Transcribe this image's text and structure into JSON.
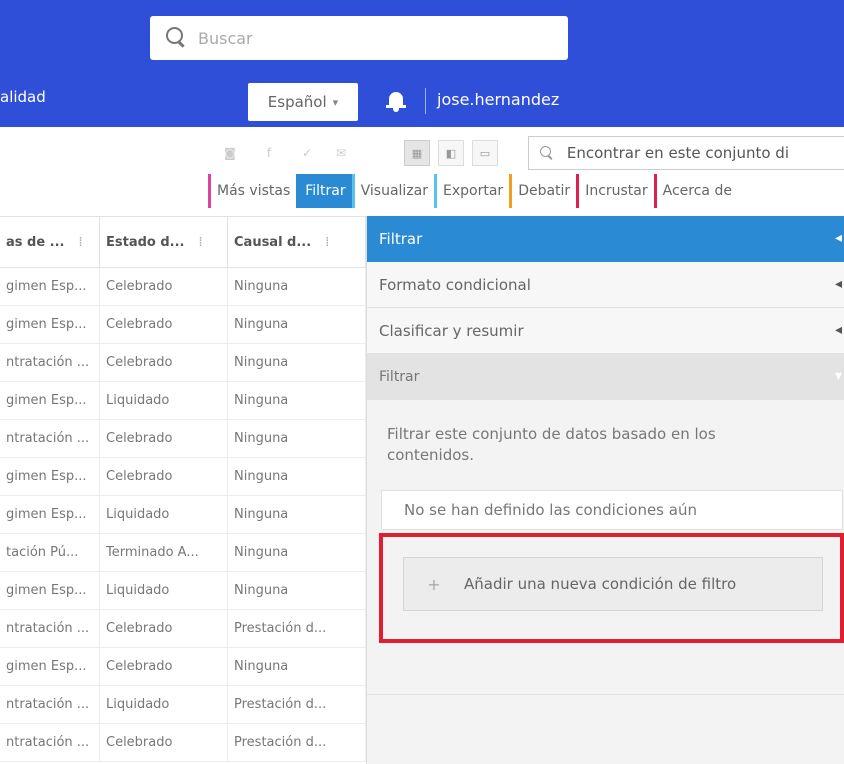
{
  "header": {
    "search_placeholder": "Buscar",
    "nav_left_label": "alidad",
    "language": "Español",
    "user_name": "jose.hernandez"
  },
  "toolbar": {
    "find_placeholder": "Encontrar en este conjunto di",
    "tabs": [
      {
        "label": "Más vistas",
        "color": "#e040a0"
      },
      {
        "label": "Filtrar",
        "color": "#2a8ad4",
        "active": true
      },
      {
        "label": "Visualizar",
        "color": "#5bc0eb"
      },
      {
        "label": "Exportar",
        "color": "#5bc0eb"
      },
      {
        "label": "Debatir",
        "color": "#f0a020"
      },
      {
        "label": "Incrustar",
        "color": "#e01e50"
      },
      {
        "label": "Acerca de",
        "color": "#e01e50"
      }
    ]
  },
  "grid": {
    "headers": [
      "as de ...",
      "Estado d...",
      "Causal d..."
    ],
    "rows": [
      [
        "gimen Esp...",
        "Celebrado",
        "Ninguna"
      ],
      [
        "gimen Esp...",
        "Celebrado",
        "Ninguna"
      ],
      [
        "ntratación ...",
        "Celebrado",
        "Ninguna"
      ],
      [
        "gimen Esp...",
        "Liquidado",
        "Ninguna"
      ],
      [
        "ntratación ...",
        "Celebrado",
        "Ninguna"
      ],
      [
        "gimen Esp...",
        "Celebrado",
        "Ninguna"
      ],
      [
        "gimen Esp...",
        "Liquidado",
        "Ninguna"
      ],
      [
        "tación Pú...",
        "Terminado A...",
        "Ninguna"
      ],
      [
        "gimen Esp...",
        "Liquidado",
        "Ninguna"
      ],
      [
        "ntratación ...",
        "Celebrado",
        "Prestación d..."
      ],
      [
        "gimen Esp...",
        "Celebrado",
        "Ninguna"
      ],
      [
        "ntratación ...",
        "Liquidado",
        "Prestación d..."
      ],
      [
        "ntratación ...",
        "Celebrado",
        "Prestación d..."
      ]
    ]
  },
  "panel": {
    "title": "Filtrar",
    "sections": [
      {
        "label": "Formato condicional"
      },
      {
        "label": "Clasificar y resumir"
      },
      {
        "label": "Filtrar"
      }
    ],
    "description": "Filtrar este conjunto de datos basado en los contenidos.",
    "no_conditions": "No se han definido las condiciones aún",
    "add_condition": "Añadir una nueva condición de filtro"
  },
  "colors": {
    "header_bg": "#2f4fd8",
    "accent": "#2a8ad4",
    "highlight": "#e01e2e"
  }
}
